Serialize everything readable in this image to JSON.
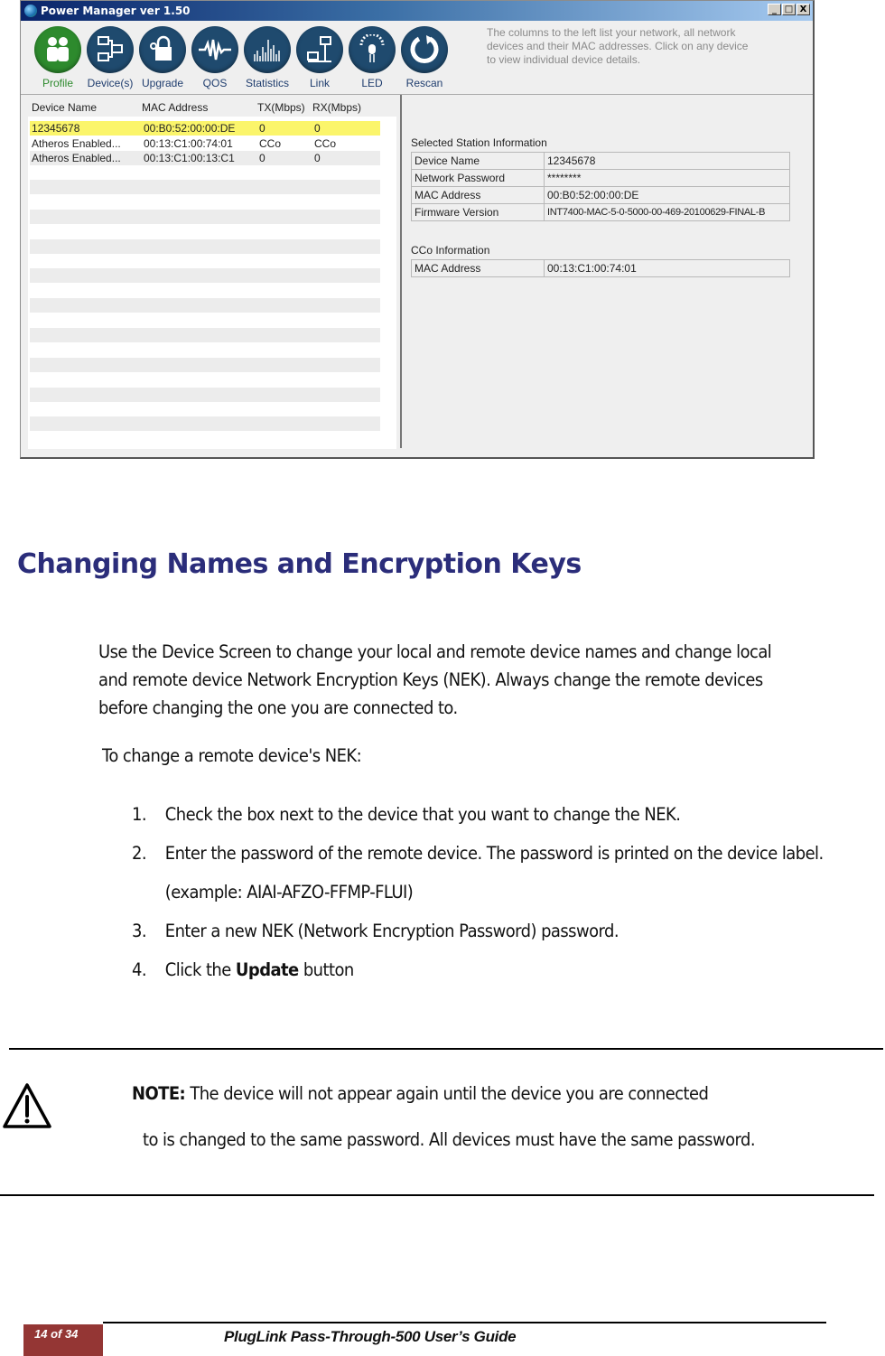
{
  "window": {
    "title": "Power Manager ver 1.50",
    "controls": {
      "minimize": "_",
      "maximize": "□",
      "close": "X"
    },
    "toolbar": [
      {
        "label": "Profile",
        "icon": "people-icon",
        "glyph": "👫",
        "active": true
      },
      {
        "label": "Device(s)",
        "icon": "devices-icon",
        "glyph": "🖧",
        "active": false
      },
      {
        "label": "Upgrade",
        "icon": "lock-upgrade-icon",
        "glyph": "🔒",
        "active": false
      },
      {
        "label": "QOS",
        "icon": "waveform-icon",
        "glyph": "〰",
        "active": false
      },
      {
        "label": "Statistics",
        "icon": "histogram-icon",
        "glyph": "▥",
        "active": false
      },
      {
        "label": "Link",
        "icon": "network-link-icon",
        "glyph": "🖧",
        "active": false
      },
      {
        "label": "LED",
        "icon": "led-icon",
        "glyph": "⚲",
        "active": false
      },
      {
        "label": "Rescan",
        "icon": "rescan-icon",
        "glyph": "↻",
        "active": false
      }
    ],
    "hint_text": "The columns to the left list your network, all network devices and their MAC addresses. Click on any device to view individual device details.",
    "device_list": {
      "columns": [
        "Device Name",
        "MAC Address",
        "TX(Mbps)",
        "RX(Mbps)"
      ],
      "rows": [
        {
          "name": "12345678",
          "mac": "00:B0:52:00:00:DE",
          "tx": "0",
          "rx": "0",
          "selected": true
        },
        {
          "name": "Atheros Enabled...",
          "mac": "00:13:C1:00:74:01",
          "tx": "CCo",
          "rx": "CCo",
          "selected": false
        },
        {
          "name": "Atheros Enabled...",
          "mac": "00:13:C1:00:13:C1",
          "tx": "0",
          "rx": "0",
          "selected": false
        }
      ]
    },
    "selected_station": {
      "caption": "Selected Station Information",
      "fields": [
        {
          "key": "Device Name",
          "value": "12345678"
        },
        {
          "key": "Network Password",
          "value": "********"
        },
        {
          "key": "MAC Address",
          "value": "00:B0:52:00:00:DE"
        },
        {
          "key": "Firmware Version",
          "value": "INT7400-MAC-5-0-5000-00-469-20100629-FINAL-B"
        }
      ]
    },
    "cco": {
      "caption": "CCo Information",
      "fields": [
        {
          "key": "MAC Address",
          "value": "00:13:C1:00:74:01"
        }
      ]
    }
  },
  "document": {
    "heading": "Changing Names and Encryption Keys",
    "intro": "Use the Device Screen to change your local and remote device names and change local and remote device Network Encryption Keys (NEK). Always change the remote devices before changing the one you are connected to.",
    "lead": "To change a remote device's NEK:",
    "steps": [
      {
        "num": "1.",
        "text": "Check the box next to the device that you want to change the NEK."
      },
      {
        "num": "2.",
        "text": "Enter the password of the remote device. The password is printed on the device label. (example: AIAI-AFZO-FFMP-FLUI)"
      },
      {
        "num": "3.",
        "text": "Enter a new NEK (Network Encryption Password) password."
      },
      {
        "num": "4.",
        "pre": "Click the ",
        "bold": "Update",
        "post": " button"
      }
    ],
    "note": {
      "label": "NOTE:",
      "line1": " The device will not appear again until the device you are connected",
      "line2": "to is changed to the same password. All devices must have the same password."
    }
  },
  "footer": {
    "page": "14  of  34",
    "title": "PlugLink Pass-Through-500 User’s Guide",
    "accent": "#943634"
  }
}
